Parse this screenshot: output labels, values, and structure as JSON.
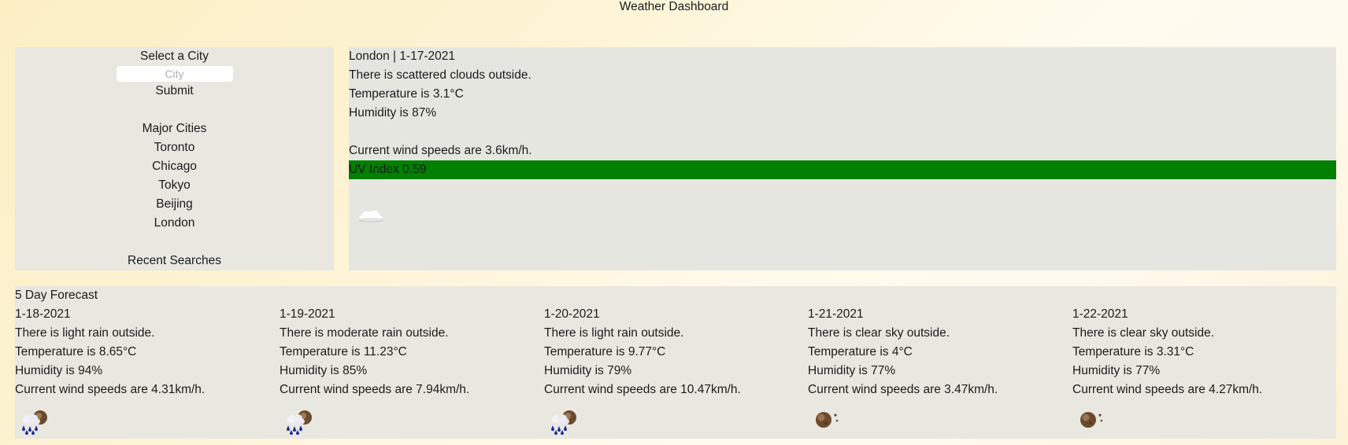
{
  "page": {
    "title": "Weather Dashboard"
  },
  "sidebar": {
    "select_label": "Select a City",
    "input_placeholder": "City",
    "submit_label": "Submit",
    "major_heading": "Major Cities",
    "major_cities": [
      "Toronto",
      "Chicago",
      "Tokyo",
      "Beijing",
      "London"
    ],
    "recent_heading": "Recent Searches"
  },
  "current": {
    "header": "London | 1-17-2021",
    "description": "There is scattered clouds outside.",
    "temperature": "Temperature is 3.1°C",
    "humidity": "Humidity is 87%",
    "wind": "Current wind speeds are 3.6km/h.",
    "uv": "UV Index 0.59",
    "uv_color": "#008000",
    "icon": "cloud-icon"
  },
  "forecast": {
    "heading": "5 Day Forecast",
    "days": [
      {
        "date": "1-18-2021",
        "description": "There is light rain outside.",
        "temperature": "Temperature is 8.65°C",
        "humidity": "Humidity is 94%",
        "wind": "Current wind speeds are 4.31km/h.",
        "icon": "rain-icon"
      },
      {
        "date": "1-19-2021",
        "description": "There is moderate rain outside.",
        "temperature": "Temperature is 11.23°C",
        "humidity": "Humidity is 85%",
        "wind": "Current wind speeds are 7.94km/h.",
        "icon": "rain-icon"
      },
      {
        "date": "1-20-2021",
        "description": "There is light rain outside.",
        "temperature": "Temperature is 9.77°C",
        "humidity": "Humidity is 79%",
        "wind": "Current wind speeds are 10.47km/h.",
        "icon": "rain-icon"
      },
      {
        "date": "1-21-2021",
        "description": "There is clear sky outside.",
        "temperature": "Temperature is 4°C",
        "humidity": "Humidity is 77%",
        "wind": "Current wind speeds are 3.47km/h.",
        "icon": "clear-night-icon"
      },
      {
        "date": "1-22-2021",
        "description": "There is clear sky outside.",
        "temperature": "Temperature is 3.31°C",
        "humidity": "Humidity is 77%",
        "wind": "Current wind speeds are 4.27km/h.",
        "icon": "clear-night-icon"
      }
    ]
  }
}
